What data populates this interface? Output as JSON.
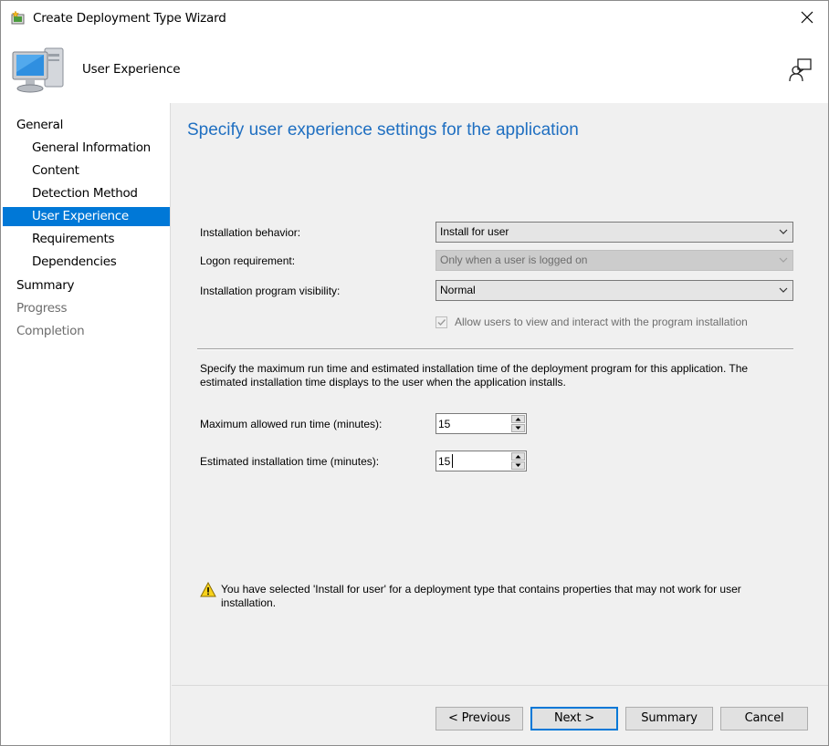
{
  "window": {
    "title": "Create Deployment Type Wizard"
  },
  "banner": {
    "title": "User Experience"
  },
  "nav": {
    "items": [
      {
        "label": "General"
      },
      {
        "label": "General Information"
      },
      {
        "label": "Content"
      },
      {
        "label": "Detection Method"
      },
      {
        "label": "User Experience"
      },
      {
        "label": "Requirements"
      },
      {
        "label": "Dependencies"
      },
      {
        "label": "Summary"
      },
      {
        "label": "Progress"
      },
      {
        "label": "Completion"
      }
    ],
    "selected": "User Experience"
  },
  "main": {
    "heading": "Specify user experience settings for the application",
    "installation_behavior": {
      "label": "Installation behavior:",
      "value": "Install for user"
    },
    "logon_requirement": {
      "label": "Logon requirement:",
      "value": "Only when a user is logged on"
    },
    "program_visibility": {
      "label": "Installation program visibility:",
      "value": "Normal"
    },
    "allow_interact": {
      "label": "Allow users to view and interact with the program installation",
      "checked": true,
      "enabled": false
    },
    "description": "Specify the maximum run time and estimated installation time of the deployment program for this application. The estimated installation time displays to the user when the application installs.",
    "max_run_time": {
      "label": "Maximum allowed run time (minutes):",
      "value": "15"
    },
    "est_install_time": {
      "label": "Estimated installation time (minutes):",
      "value": "15"
    },
    "warning": "You have selected 'Install for user' for a deployment type that contains properties that may not work for user installation."
  },
  "footer": {
    "previous": "< Previous",
    "next": "Next >",
    "summary": "Summary",
    "cancel": "Cancel"
  },
  "colors": {
    "selection": "#0078d7",
    "heading": "#1f6fc1",
    "primary_border": "#0078d7"
  }
}
